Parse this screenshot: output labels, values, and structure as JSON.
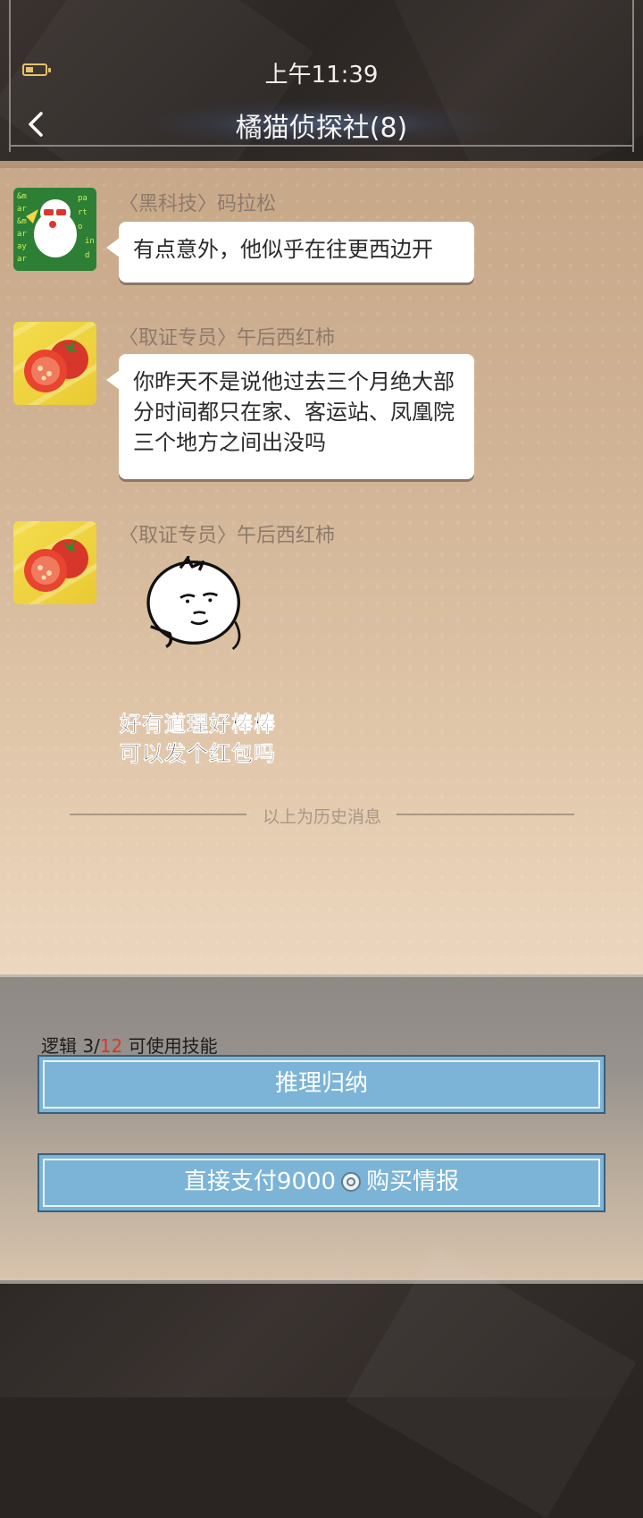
{
  "status_bar": {
    "time": "上午11:39"
  },
  "header": {
    "title": "橘猫侦探社(8)"
  },
  "messages": [
    {
      "sender": "〈黑科技〉码拉松",
      "text": "有点意外，他似乎在往更西边开"
    },
    {
      "sender": "〈取证专员〉午后西红柿",
      "text": "你昨天不是说他过去三个月绝大部分时间都只在家、客运站、凤凰院三个地方之间出没吗"
    },
    {
      "sender": "〈取证专员〉午后西红柿",
      "sticker_line1": "好有道理好棒棒",
      "sticker_line2": "可以发个红包吗"
    }
  ],
  "divider": {
    "text": "以上为历史消息"
  },
  "skill": {
    "prefix": "逻辑 3/",
    "max": "12",
    "suffix": " 可使用技能"
  },
  "buttons": {
    "reason": "推理归纳",
    "pay_prefix": "直接支付9000",
    "pay_suffix": "购买情报"
  },
  "colors": {
    "accent_red": "#d53a2a",
    "button_blue": "#7bb4d6"
  }
}
